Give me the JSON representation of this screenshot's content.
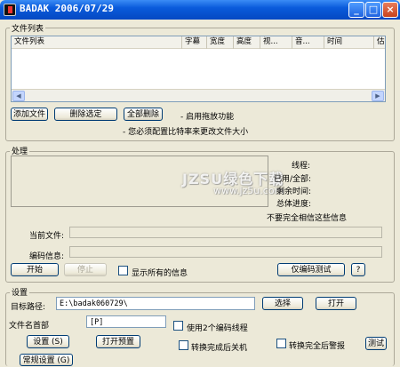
{
  "window": {
    "title": "BADAK 2006/07/29",
    "minimize": "_",
    "maximize": "□",
    "close": "×"
  },
  "file_list": {
    "legend": "文件列表",
    "columns": [
      "文件列表",
      "字幕",
      "宽度",
      "高度",
      "视...",
      "音...",
      "时间",
      "估"
    ],
    "buttons": {
      "add": "添加文件",
      "remove_selected": "删除选定",
      "remove_all": "全部删除"
    },
    "drag_drop_text": "- 启用拖放功能",
    "bitrate_note": "- 您必须配置比特率来更改文件大小"
  },
  "processing": {
    "legend": "处理",
    "labels": {
      "thread": "线程:",
      "used_total": "已用/全部:",
      "remaining": "剩余时间:",
      "total_progress": "总体进度:"
    },
    "disclaimer": "不要完全相信这些信息",
    "current_file_label": "当前文件:",
    "encode_info_label": "编码信息:",
    "buttons": {
      "start": "开始",
      "stop": "停止",
      "encode_test": "仅编码测试",
      "help": "?"
    },
    "show_all_info": "显示所有的信息"
  },
  "watermark": {
    "main": "JZSU绿色下载",
    "url": "www.jz5u.com"
  },
  "settings": {
    "legend": "设置",
    "target_path_label": "目标路径:",
    "target_path_value": "E:\\badak060729\\",
    "select_button": "选择",
    "open_button": "打开",
    "filename_header_label": "文件名首部",
    "filename_header_value": "[P]",
    "use_two_threads": "使用2个编码线程",
    "settings_button": "设置 (S)",
    "open_preset_button": "打开预置",
    "shutdown_after": "转换完成后关机",
    "alarm_after": "转换完全后警报",
    "test_button": "测试",
    "general_settings_button": "常规设置 (G)"
  }
}
